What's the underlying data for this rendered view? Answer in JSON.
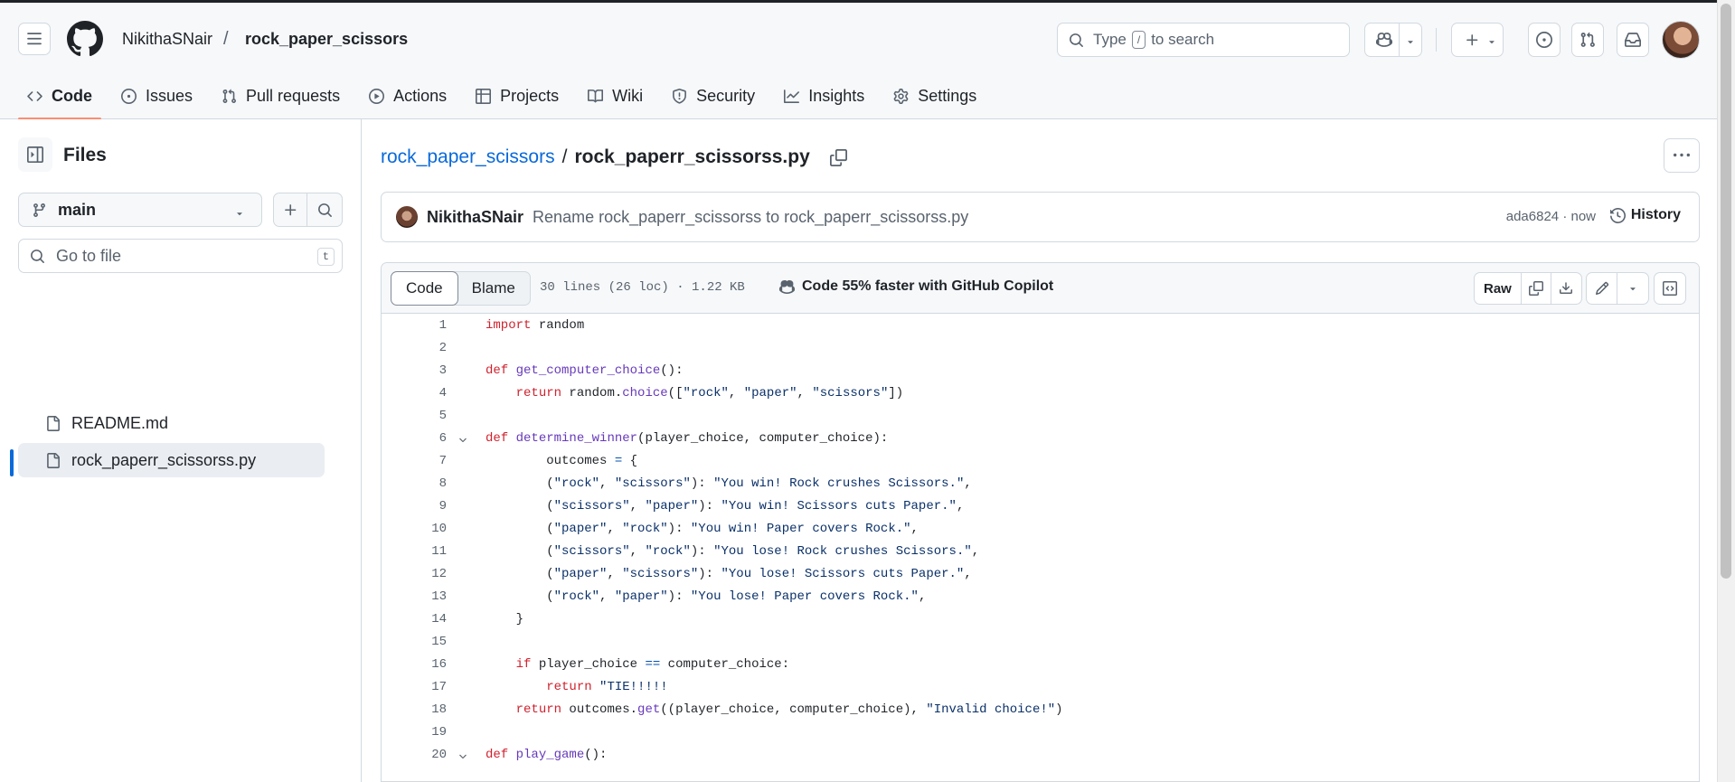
{
  "header": {
    "owner": "NikithaSNair",
    "separator": "/",
    "repo": "rock_paper_scissors",
    "search": {
      "prefix": "Type",
      "key": "/",
      "suffix": "to search"
    }
  },
  "tabs": [
    {
      "label": "Code",
      "icon": "code-icon",
      "active": true
    },
    {
      "label": "Issues",
      "icon": "issue-icon"
    },
    {
      "label": "Pull requests",
      "icon": "pull-request-icon"
    },
    {
      "label": "Actions",
      "icon": "play-icon"
    },
    {
      "label": "Projects",
      "icon": "table-icon"
    },
    {
      "label": "Wiki",
      "icon": "book-icon"
    },
    {
      "label": "Security",
      "icon": "shield-icon"
    },
    {
      "label": "Insights",
      "icon": "graph-icon"
    },
    {
      "label": "Settings",
      "icon": "gear-icon"
    }
  ],
  "sidebar": {
    "title": "Files",
    "branch": "main",
    "goto_placeholder": "Go to file",
    "goto_key": "t",
    "files": [
      {
        "name": "README.md",
        "selected": false
      },
      {
        "name": "rock_paperr_scissorss.py",
        "selected": true
      }
    ]
  },
  "path": {
    "repo": "rock_paper_scissors",
    "sep": "/",
    "file": "rock_paperr_scissorss.py"
  },
  "commit": {
    "author": "NikithaSNair",
    "message": "Rename rock_paperr_scissorss to rock_paperr_scissorss.py",
    "meta": "ada6824 · now",
    "history": "History"
  },
  "file": {
    "view_code": "Code",
    "view_blame": "Blame",
    "meta": "30 lines (26 loc) · 1.22 KB",
    "copilot": "Code 55% faster with GitHub Copilot",
    "raw": "Raw"
  },
  "code_lines": [
    {
      "n": "1",
      "t": "import random"
    },
    {
      "n": "2",
      "t": ""
    },
    {
      "n": "3",
      "t": "def get_computer_choice():"
    },
    {
      "n": "4",
      "t": "    return random.choice([\"rock\", \"paper\", \"scissors\"])"
    },
    {
      "n": "5",
      "t": ""
    },
    {
      "n": "6",
      "t": "def determine_winner(player_choice, computer_choice):",
      "fold": true
    },
    {
      "n": "7",
      "t": "        outcomes = {"
    },
    {
      "n": "8",
      "t": "        (\"rock\", \"scissors\"): \"You win! Rock crushes Scissors.\","
    },
    {
      "n": "9",
      "t": "        (\"scissors\", \"paper\"): \"You win! Scissors cuts Paper.\","
    },
    {
      "n": "10",
      "t": "        (\"paper\", \"rock\"): \"You win! Paper covers Rock.\","
    },
    {
      "n": "11",
      "t": "        (\"scissors\", \"rock\"): \"You lose! Rock crushes Scissors.\","
    },
    {
      "n": "12",
      "t": "        (\"paper\", \"scissors\"): \"You lose! Scissors cuts Paper.\","
    },
    {
      "n": "13",
      "t": "        (\"rock\", \"paper\"): \"You lose! Paper covers Rock.\","
    },
    {
      "n": "14",
      "t": "    }"
    },
    {
      "n": "15",
      "t": ""
    },
    {
      "n": "16",
      "t": "    if player_choice == computer_choice:"
    },
    {
      "n": "17",
      "t": "        return \"TIE!!!!!"
    },
    {
      "n": "18",
      "t": "    return outcomes.get((player_choice, computer_choice), \"Invalid choice!\")"
    },
    {
      "n": "19",
      "t": ""
    },
    {
      "n": "20",
      "t": "def play_game():",
      "fold": true
    }
  ],
  "colors": {
    "accent": "#0969da",
    "tab_underline": "#fd8c73",
    "keyword": "#cf222e",
    "function": "#6639ba",
    "string": "#0a3069",
    "operator": "#0550ae"
  }
}
